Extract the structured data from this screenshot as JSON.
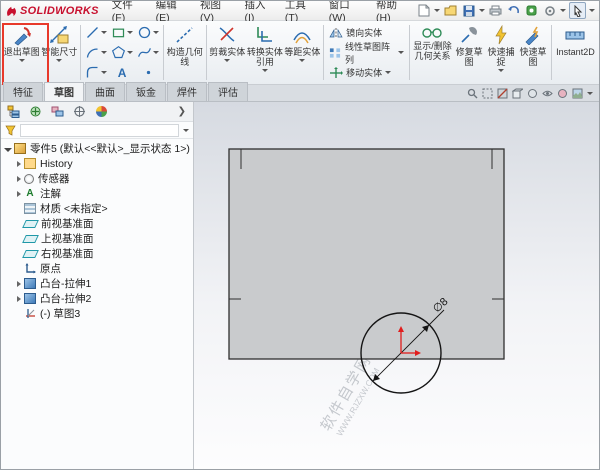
{
  "menubar": {
    "logo": "SOLIDWORKS",
    "items": [
      "文件(F)",
      "编辑(E)",
      "视图(V)",
      "插入(I)",
      "工具(T)",
      "窗口(W)",
      "帮助(H)"
    ]
  },
  "ribbon": {
    "exit_sketch": "退出草图",
    "smart_dimension": "智能尺寸",
    "construction_geometry": "构造几何线",
    "trim_entities": "剪裁实体",
    "convert_entities": "转换实体引用",
    "offset_entities": "等距实体",
    "mirror_entities": "镜向实体",
    "linear_pattern": "线性草图阵列",
    "move_entities": "移动实体",
    "display_relations": "显示/删除几何关系",
    "repair_sketch": "修复草图",
    "quick_snaps": "快速捕捉",
    "rapid_sketch": "快速草图",
    "instant2d": "Instant2D"
  },
  "tabs": [
    "特征",
    "草图",
    "曲面",
    "钣金",
    "焊件",
    "评估"
  ],
  "tree": {
    "items": [
      {
        "label": "零件5 (默认<<默认>_显示状态 1>)"
      },
      {
        "label": "History"
      },
      {
        "label": "传感器"
      },
      {
        "label": "注解"
      },
      {
        "label": "材质 <未指定>"
      },
      {
        "label": "前视基准面"
      },
      {
        "label": "上视基准面"
      },
      {
        "label": "右视基准面"
      },
      {
        "label": "原点"
      },
      {
        "label": "凸台-拉伸1"
      },
      {
        "label": "凸台-拉伸2"
      },
      {
        "label": "(-) 草图3"
      }
    ]
  },
  "viewport": {
    "dimension_label": "∅8",
    "watermark_cn": "软件自学网",
    "watermark_en": "WWW.RJZXW.COM"
  },
  "glyphs": {
    "annotation": "A",
    "text_tool": "A"
  },
  "colors": {
    "accent_red": "#e8392b",
    "logo_red": "#c8102e",
    "part_fill": "#c9cbcd",
    "sketch_origin": "#e11d1d"
  }
}
